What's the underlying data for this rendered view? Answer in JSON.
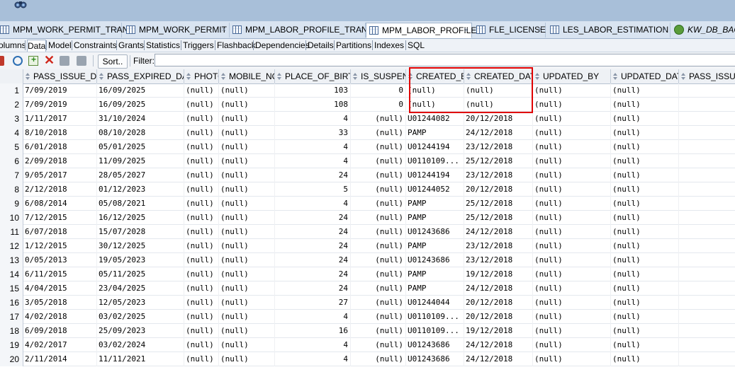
{
  "tabs": [
    {
      "label": "MPM_WORK_PERMIT_TRANS",
      "icon": "table-icon",
      "active": false
    },
    {
      "label": "MPM_WORK_PERMIT",
      "icon": "table-icon",
      "active": false
    },
    {
      "label": "MPM_LABOR_PROFILE_TRANS",
      "icon": "table-icon",
      "active": false
    },
    {
      "label": "MPM_LABOR_PROFILE",
      "icon": "table-icon",
      "active": true
    },
    {
      "label": "FLE_LICENSE",
      "icon": "table-icon",
      "active": false
    },
    {
      "label": "LES_LABOR_ESTIMATION",
      "icon": "table-icon",
      "active": false
    },
    {
      "label": "KW_DB_BAC",
      "icon": "sql-connection-icon",
      "active": false
    }
  ],
  "tab_close_glyph": "×",
  "subtabs": [
    "olumns",
    "Data",
    "Model",
    "Constraints",
    "Grants",
    "Statistics",
    "Triggers",
    "Flashback",
    "Dependencies",
    "Details",
    "Partitions",
    "Indexes",
    "SQL"
  ],
  "toolbar": {
    "sort_label": "Sort..",
    "filter_label": "Filter:",
    "filter_value": ""
  },
  "columns": [
    "PASS_ISSUE_DATE",
    "PASS_EXPIRED_DATE",
    "PHOTO",
    "MOBILE_NO",
    "PLACE_OF_BIRTH",
    "IS_SUSPEND",
    "CREATED_BY",
    "CREATED_DATE",
    "UPDATED_BY",
    "UPDATED_DATE",
    "PASS_ISSUE_"
  ],
  "rows": [
    {
      "n": "1",
      "c": [
        "7/09/2019",
        "16/09/2025",
        "(null)",
        "(null)",
        "103",
        "0",
        "(null)",
        "(null)",
        "(null)",
        "(null)"
      ]
    },
    {
      "n": "2",
      "c": [
        "7/09/2019",
        "16/09/2025",
        "(null)",
        "(null)",
        "108",
        "0",
        "(null)",
        "(null)",
        "(null)",
        "(null)"
      ]
    },
    {
      "n": "3",
      "c": [
        "1/11/2017",
        "31/10/2024",
        "(null)",
        "(null)",
        "4",
        "(null)",
        "U01244082",
        "20/12/2018",
        "(null)",
        "(null)"
      ]
    },
    {
      "n": "4",
      "c": [
        "8/10/2018",
        "08/10/2028",
        "(null)",
        "(null)",
        "33",
        "(null)",
        "PAMP",
        "24/12/2018",
        "(null)",
        "(null)"
      ]
    },
    {
      "n": "5",
      "c": [
        "6/01/2018",
        "05/01/2025",
        "(null)",
        "(null)",
        "4",
        "(null)",
        "U01244194",
        "23/12/2018",
        "(null)",
        "(null)"
      ]
    },
    {
      "n": "6",
      "c": [
        "2/09/2018",
        "11/09/2025",
        "(null)",
        "(null)",
        "4",
        "(null)",
        "U0110109...",
        "25/12/2018",
        "(null)",
        "(null)"
      ]
    },
    {
      "n": "7",
      "c": [
        "9/05/2017",
        "28/05/2027",
        "(null)",
        "(null)",
        "24",
        "(null)",
        "U01244194",
        "23/12/2018",
        "(null)",
        "(null)"
      ]
    },
    {
      "n": "8",
      "c": [
        "2/12/2018",
        "01/12/2023",
        "(null)",
        "(null)",
        "5",
        "(null)",
        "U01244052",
        "20/12/2018",
        "(null)",
        "(null)"
      ]
    },
    {
      "n": "9",
      "c": [
        "6/08/2014",
        "05/08/2021",
        "(null)",
        "(null)",
        "4",
        "(null)",
        "PAMP",
        "25/12/2018",
        "(null)",
        "(null)"
      ]
    },
    {
      "n": "10",
      "c": [
        "7/12/2015",
        "16/12/2025",
        "(null)",
        "(null)",
        "24",
        "(null)",
        "PAMP",
        "25/12/2018",
        "(null)",
        "(null)"
      ]
    },
    {
      "n": "11",
      "c": [
        "6/07/2018",
        "15/07/2028",
        "(null)",
        "(null)",
        "24",
        "(null)",
        "U01243686",
        "24/12/2018",
        "(null)",
        "(null)"
      ]
    },
    {
      "n": "12",
      "c": [
        "1/12/2015",
        "30/12/2025",
        "(null)",
        "(null)",
        "24",
        "(null)",
        "PAMP",
        "23/12/2018",
        "(null)",
        "(null)"
      ]
    },
    {
      "n": "13",
      "c": [
        "0/05/2013",
        "19/05/2023",
        "(null)",
        "(null)",
        "24",
        "(null)",
        "U01243686",
        "23/12/2018",
        "(null)",
        "(null)"
      ]
    },
    {
      "n": "14",
      "c": [
        "6/11/2015",
        "05/11/2025",
        "(null)",
        "(null)",
        "24",
        "(null)",
        "PAMP",
        "19/12/2018",
        "(null)",
        "(null)"
      ]
    },
    {
      "n": "15",
      "c": [
        "4/04/2015",
        "23/04/2025",
        "(null)",
        "(null)",
        "24",
        "(null)",
        "PAMP",
        "24/12/2018",
        "(null)",
        "(null)"
      ]
    },
    {
      "n": "16",
      "c": [
        "3/05/2018",
        "12/05/2023",
        "(null)",
        "(null)",
        "27",
        "(null)",
        "U01244044",
        "20/12/2018",
        "(null)",
        "(null)"
      ]
    },
    {
      "n": "17",
      "c": [
        "4/02/2018",
        "03/02/2025",
        "(null)",
        "(null)",
        "4",
        "(null)",
        "U0110109...",
        "20/12/2018",
        "(null)",
        "(null)"
      ]
    },
    {
      "n": "18",
      "c": [
        "6/09/2018",
        "25/09/2023",
        "(null)",
        "(null)",
        "16",
        "(null)",
        "U0110109...",
        "19/12/2018",
        "(null)",
        "(null)"
      ]
    },
    {
      "n": "19",
      "c": [
        "4/02/2017",
        "03/02/2024",
        "(null)",
        "(null)",
        "4",
        "(null)",
        "U01243686",
        "24/12/2018",
        "(null)",
        "(null)"
      ]
    },
    {
      "n": "20",
      "c": [
        "2/11/2014",
        "11/11/2021",
        "(null)",
        "(null)",
        "4",
        "(null)",
        "U01243686",
        "24/12/2018",
        "(null)",
        "(null)"
      ]
    }
  ],
  "colors": {
    "highlight": "#e00000",
    "tabbar": "#d9e4f1",
    "titlebar": "#a8bfd9"
  }
}
